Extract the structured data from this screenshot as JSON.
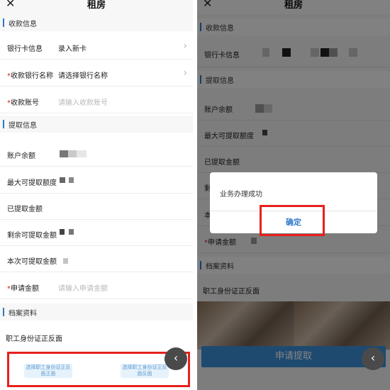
{
  "page_title": "租房",
  "left": {
    "sections": {
      "receive": "收款信息",
      "withdraw": "提取信息",
      "archive": "档案资料"
    },
    "rows": {
      "bank_card_label": "银行卡信息",
      "bank_card_value": "录入新卡",
      "bank_name_label": "收款银行名称",
      "bank_name_value": "请选择银行名称",
      "account_label": "收款账号",
      "account_placeholder": "请输入收款账号",
      "balance_label": "账户余额",
      "max_label": "最大可提取额度",
      "withdrawn_label": "已提取金额",
      "remaining_label": "剩余可提取金额",
      "this_time_label": "本次可提取金额",
      "apply_amount_label": "申请金额",
      "apply_amount_placeholder": "请输入申请金额",
      "id_label": "职工身份证正反面"
    },
    "required_mark": "*",
    "upload_front": "选择职工身份证正反面正面",
    "upload_back": "选择职工身份证正反面反面",
    "back_icon_glyph": "‹"
  },
  "right": {
    "sections": {
      "receive": "收款信息",
      "withdraw": "提取信息",
      "archive": "档案资料"
    },
    "rows": {
      "bank_card_label": "银行卡信息",
      "balance_label": "账户余额",
      "max_label": "最大可提取额度",
      "withdrawn_label": "已提取金额",
      "remaining_label_partial": "剩",
      "this_time_label_partial": "本",
      "apply_amount_label": "申请金额",
      "id_label": "职工身份证正反面"
    },
    "required_mark": "*",
    "dialog": {
      "message": "业务办理成功",
      "confirm": "确定"
    },
    "apply_button": "申请提取",
    "back_icon_glyph": "‹"
  },
  "icons": {
    "close": "✕",
    "more": "···",
    "chevron": "›"
  },
  "colors": {
    "accent": "#2c78c9",
    "required": "#d42020",
    "highlight": "#e8201c",
    "button": "#3a8fd6"
  }
}
